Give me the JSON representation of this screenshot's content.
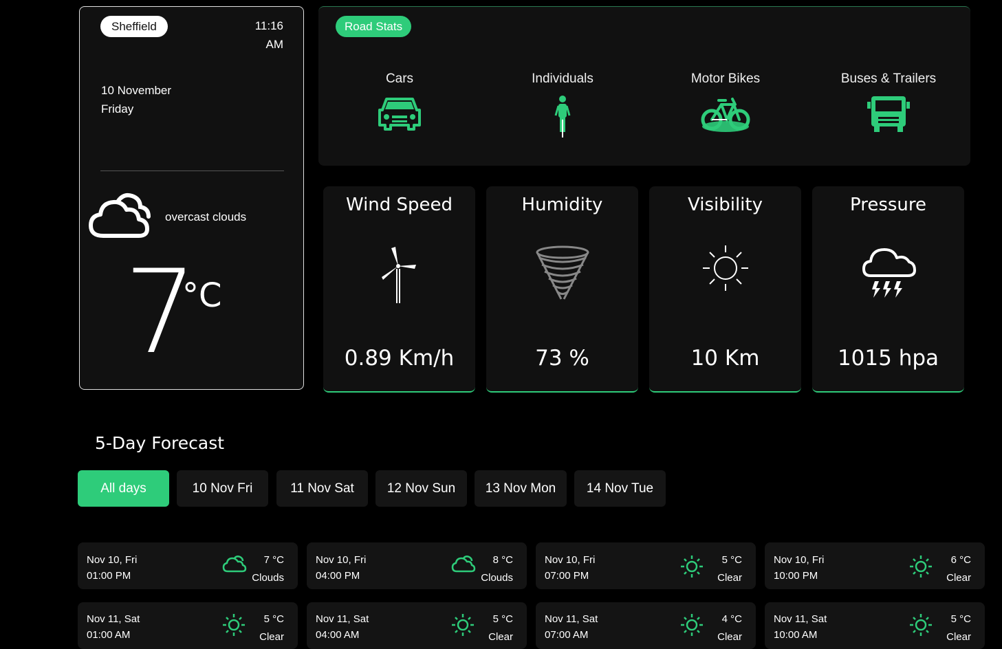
{
  "city_card": {
    "city": "Sheffield",
    "time_line1": "11:16",
    "time_line2": "AM",
    "date": "10 November",
    "weekday": "Friday",
    "description": "overcast clouds",
    "temperature": "7",
    "unit": "°C",
    "icon": "cloud-icon"
  },
  "road_stats": {
    "badge": "Road Stats",
    "items": [
      {
        "label": "Cars",
        "icon": "car-icon"
      },
      {
        "label": "Individuals",
        "icon": "pedestrian-icon"
      },
      {
        "label": "Motor Bikes",
        "icon": "bicycle-icon"
      },
      {
        "label": "Buses & Trailers",
        "icon": "bus-icon"
      }
    ]
  },
  "stats": [
    {
      "title": "Wind Speed",
      "value": "0.89 Km/h",
      "icon": "wind-turbine-icon"
    },
    {
      "title": "Humidity",
      "value": "73 %",
      "icon": "tornado-icon"
    },
    {
      "title": "Visibility",
      "value": "10 Km",
      "icon": "sun-icon"
    },
    {
      "title": "Pressure",
      "value": "1015 hpa",
      "icon": "storm-cloud-icon"
    }
  ],
  "forecast": {
    "title": "5-Day Forecast",
    "tabs": [
      "All days",
      "10 Nov Fri",
      "11 Nov Sat",
      "12 Nov Sun",
      "13 Nov Mon",
      "14 Nov Tue"
    ],
    "active_tab": "All days",
    "items": [
      {
        "date": "Nov 10, Fri",
        "time": "01:00 PM",
        "temp": "7 °C",
        "desc": "Clouds",
        "icon": "cloud-icon"
      },
      {
        "date": "Nov 10, Fri",
        "time": "04:00 PM",
        "temp": "8 °C",
        "desc": "Clouds",
        "icon": "cloud-icon"
      },
      {
        "date": "Nov 10, Fri",
        "time": "07:00 PM",
        "temp": "5 °C",
        "desc": "Clear",
        "icon": "sun-icon"
      },
      {
        "date": "Nov 10, Fri",
        "time": "10:00 PM",
        "temp": "6 °C",
        "desc": "Clear",
        "icon": "sun-icon"
      },
      {
        "date": "Nov 11, Sat",
        "time": "01:00 AM",
        "temp": "5 °C",
        "desc": "Clear",
        "icon": "sun-icon"
      },
      {
        "date": "Nov 11, Sat",
        "time": "04:00 AM",
        "temp": "5 °C",
        "desc": "Clear",
        "icon": "sun-icon"
      },
      {
        "date": "Nov 11, Sat",
        "time": "07:00 AM",
        "temp": "4 °C",
        "desc": "Clear",
        "icon": "sun-icon"
      },
      {
        "date": "Nov 11, Sat",
        "time": "10:00 AM",
        "temp": "5 °C",
        "desc": "Clear",
        "icon": "sun-icon"
      }
    ]
  },
  "colors": {
    "accent": "#2ecc7a",
    "card": "#111111",
    "background": "#000000"
  }
}
